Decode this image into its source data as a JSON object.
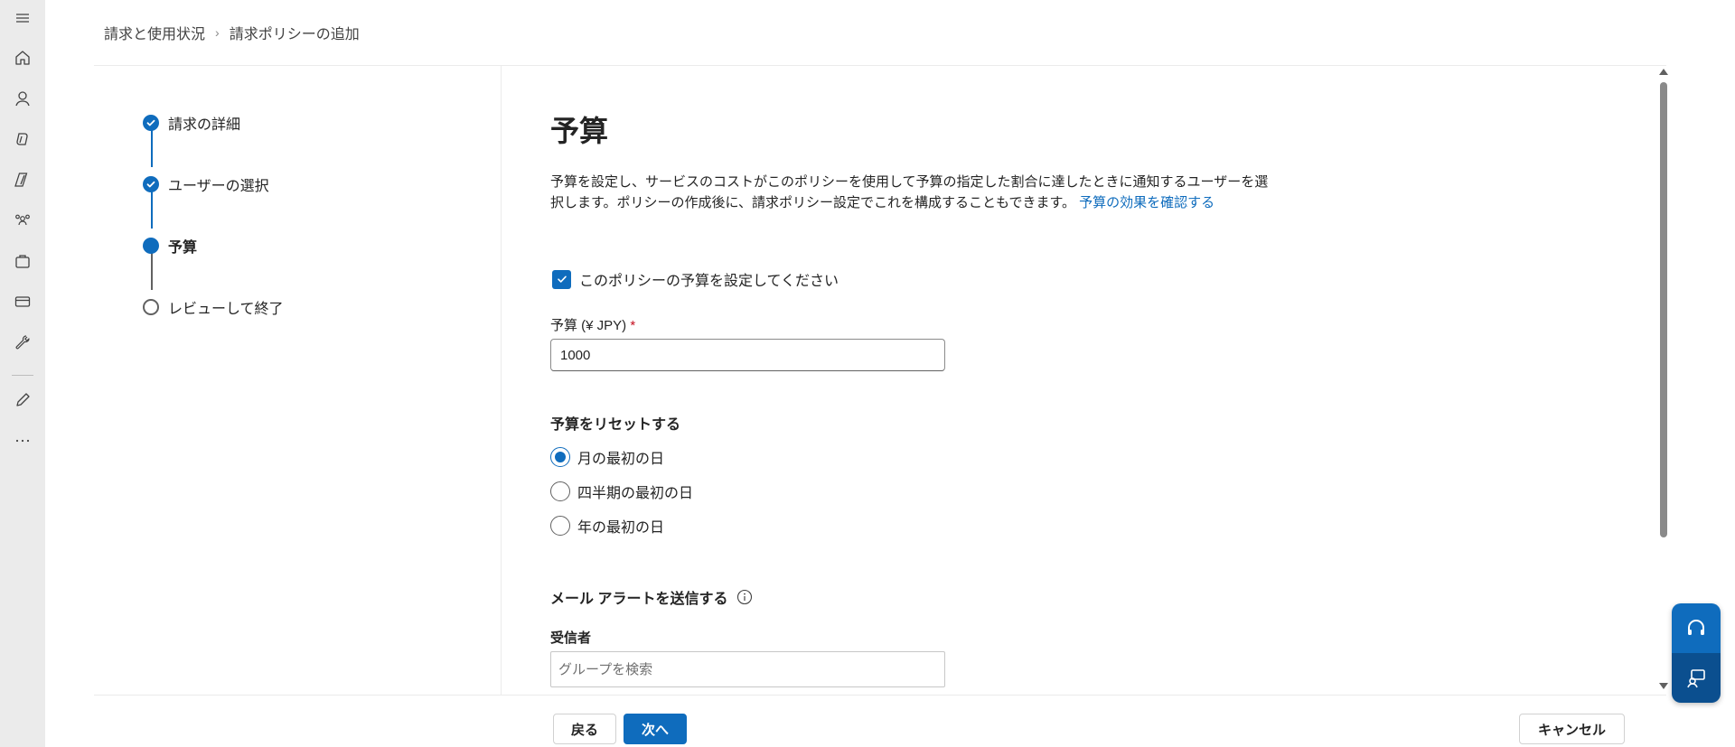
{
  "breadcrumb": {
    "parent": "請求と使用状況",
    "current": "請求ポリシーの追加"
  },
  "rail": {
    "icons": [
      "menu-icon",
      "home-icon",
      "user-icon",
      "copilot-icon",
      "admin-icon",
      "teams-icon",
      "briefcase-icon",
      "billing-card-icon",
      "wrench-icon",
      "pencil-icon",
      "more-icon"
    ]
  },
  "stepper": {
    "steps": [
      {
        "label": "請求の詳細",
        "state": "done"
      },
      {
        "label": "ユーザーの選択",
        "state": "done"
      },
      {
        "label": "予算",
        "state": "current"
      },
      {
        "label": "レビューして終了",
        "state": "todo"
      }
    ]
  },
  "main": {
    "title": "予算",
    "description": "予算を設定し、サービスのコストがこのポリシーを使用して予算の指定した割合に達したときに通知するユーザーを選択します。ポリシーの作成後に、請求ポリシー設定でこれを構成することもできます。",
    "description_link": "予算の効果を確認する",
    "set_budget_checkbox": {
      "label": "このポリシーの予算を設定してください",
      "checked": true
    },
    "budget_field": {
      "label": "予算 (¥ JPY)",
      "required_mark": "*",
      "value": "1000"
    },
    "reset_section": {
      "title": "予算をリセットする",
      "options": [
        {
          "label": "月の最初の日",
          "selected": true
        },
        {
          "label": "四半期の最初の日",
          "selected": false
        },
        {
          "label": "年の最初の日",
          "selected": false
        }
      ]
    },
    "alert_section": {
      "title": "メール アラートを送信する"
    },
    "recipients": {
      "label": "受信者",
      "placeholder": "グループを検索"
    }
  },
  "footer": {
    "back_label": "戻る",
    "next_label": "次へ",
    "cancel_label": "キャンセル"
  },
  "colors": {
    "accent": "#0f6cbd",
    "rail_bg": "#ebebeb",
    "required": "#c50f1f"
  }
}
